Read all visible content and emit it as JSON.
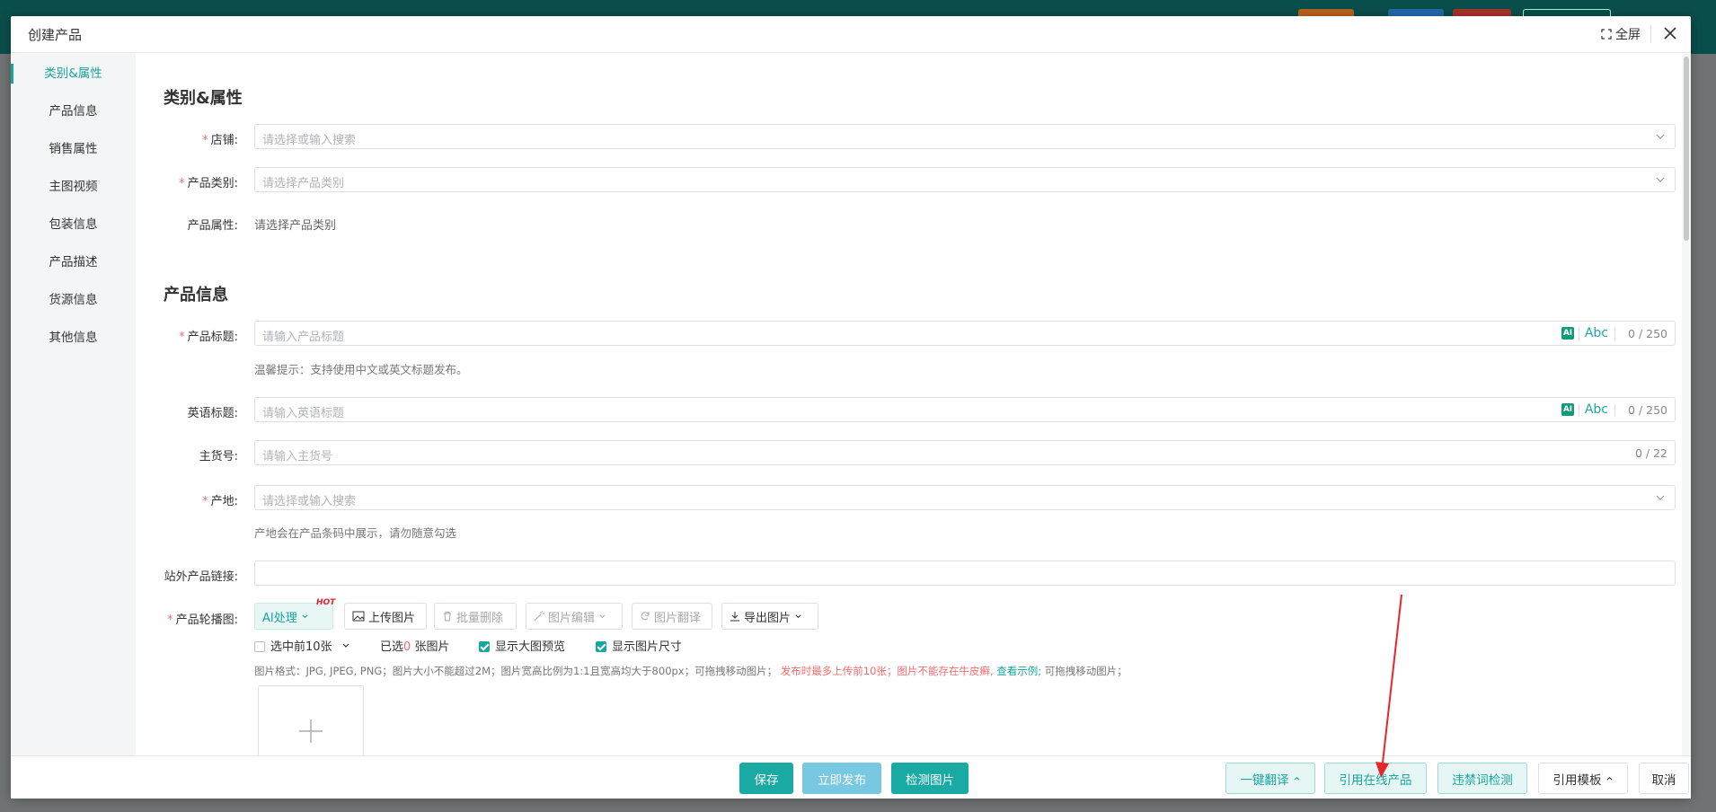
{
  "dialog": {
    "title": "创建产品",
    "fullscreen_label": "全屏"
  },
  "sidebar": {
    "items": [
      {
        "label": "类别&属性",
        "active": true
      },
      {
        "label": "产品信息"
      },
      {
        "label": "销售属性"
      },
      {
        "label": "主图视频"
      },
      {
        "label": "包装信息"
      },
      {
        "label": "产品描述"
      },
      {
        "label": "货源信息"
      },
      {
        "label": "其他信息"
      }
    ]
  },
  "category_section": {
    "title": "类别&属性",
    "shop": {
      "label": "店铺:",
      "placeholder": "请选择或输入搜索"
    },
    "product_category": {
      "label": "产品类别:",
      "placeholder": "请选择产品类别"
    },
    "product_attrs": {
      "label": "产品属性:",
      "value": "请选择产品类别"
    }
  },
  "info_section": {
    "title": "产品信息",
    "product_title": {
      "label": "产品标题:",
      "placeholder": "请输入产品标题",
      "ai": "AI",
      "abc": "Abc",
      "counter": "0 / 250",
      "hint": "温馨提示：支持使用中文或英文标题发布。"
    },
    "english_title": {
      "label": "英语标题:",
      "placeholder": "请输入英语标题",
      "ai": "AI",
      "abc": "Abc",
      "counter": "0 / 250"
    },
    "main_sku": {
      "label": "主货号:",
      "placeholder": "请输入主货号",
      "counter": "0 / 22"
    },
    "origin": {
      "label": "产地:",
      "placeholder": "请选择或输入搜索",
      "hint": "产地会在产品条码中展示，请勿随意勾选"
    },
    "external_link": {
      "label": "站外产品链接:",
      "placeholder": ""
    },
    "carousel": {
      "label": "产品轮播图:",
      "ai_btn": "AI处理",
      "hot": "HOT",
      "upload_btn": "上传图片",
      "batch_delete_btn": "批量删除",
      "edit_btn": "图片编辑",
      "translate_btn": "图片翻译",
      "export_btn": "导出图片",
      "select_first": "选中前10张",
      "selected_prefix": "已选",
      "selected_count": "0",
      "selected_suffix": "张图片",
      "show_preview": "显示大图预览",
      "show_size": "显示图片尺寸",
      "rule_text": "图片格式：JPG, JPEG, PNG；图片大小不能超过2M；图片宽高比例为1:1且宽高均大于800px；可拖拽移动图片；",
      "rule_warn": "发布时最多上传前10张；图片不能存在牛皮癣,",
      "rule_link": "查看示例;",
      "rule_tail": "可拖拽移动图片；"
    }
  },
  "footer": {
    "save": "保存",
    "publish": "立即发布",
    "check_images": "检测图片",
    "translate_all": "一键翻译",
    "cite_online": "引用在线产品",
    "banned_words": "违禁词检测",
    "cite_template": "引用模板",
    "cancel": "取消"
  },
  "colors": {
    "accent": "#1aa6a0",
    "required": "#f56c6c",
    "annotation_arrow": "#e8262a"
  }
}
